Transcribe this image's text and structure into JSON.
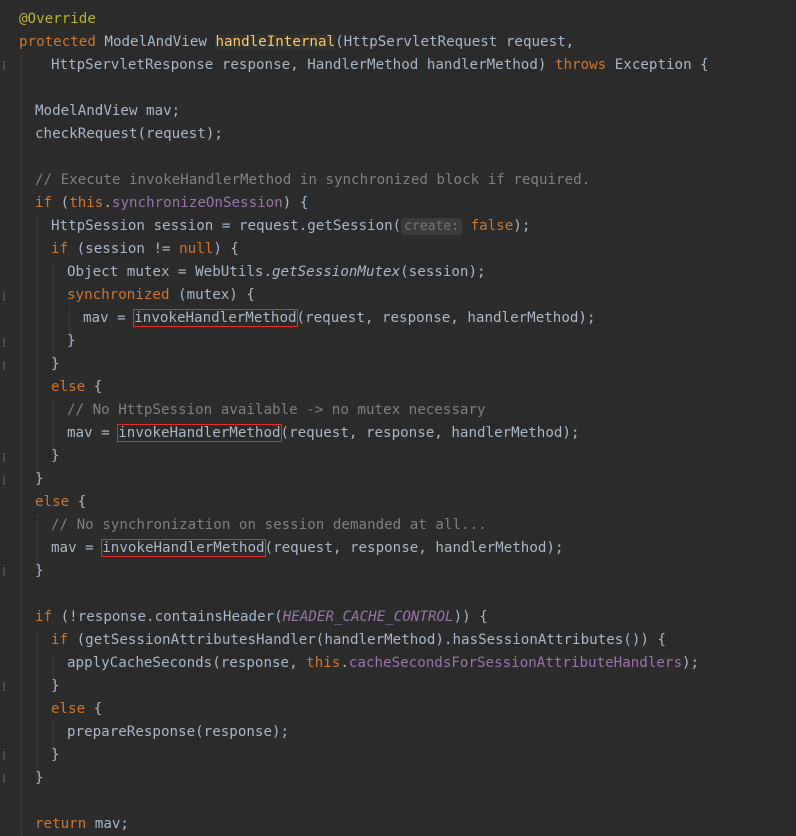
{
  "annotation": "@Override",
  "kw": {
    "protected": "protected",
    "throws": "throws",
    "if": "if",
    "this": "this",
    "null": "null",
    "synchronized": "synchronized",
    "else": "else",
    "return": "return",
    "false": "false"
  },
  "signature": {
    "return_type": "ModelAndView",
    "method": "handleInternal",
    "params1": "(HttpServletRequest request,",
    "params2": "HttpServletResponse response, HandlerMethod handlerMethod)",
    "exception": "Exception {"
  },
  "lines": {
    "l4": "ModelAndView mav;",
    "l5": "checkRequest(request);",
    "l7": "// Execute invokeHandlerMethod in synchronized block if required.",
    "l8_open": "(",
    "l8_field": "synchronizeOnSession",
    "l8_close": ") {",
    "l9a": "HttpSession session = request.getSession(",
    "l9_hint": "create:",
    "l9b": ");",
    "l10a": "(session != ",
    "l10b": ") {",
    "l11a": "Object mutex = WebUtils.",
    "l11_method": "getSessionMutex",
    "l11b": "(session);",
    "l12": "(mutex) {",
    "call_prefix": "mav = ",
    "invoke": "invokeHandlerMethod",
    "call_args": "(request, response, handlerMethod);",
    "close": "}",
    "open": "{",
    "l17": "// No HttpSession available -> no mutex necessary",
    "l22": "// No synchronization on session demanded at all...",
    "l26a": "(!response.containsHeader(",
    "l26_const": "HEADER_CACHE_CONTROL",
    "l26b": ")) {",
    "l27": "(getSessionAttributesHandler(handlerMethod).hasSessionAttributes()) {",
    "l28a": "applyCacheSeconds(response, ",
    "l28_field": "cacheSecondsForSessionAttributeHandlers",
    "l28b": ");",
    "l31": "prepareResponse(response);",
    "l35": "mav;"
  }
}
